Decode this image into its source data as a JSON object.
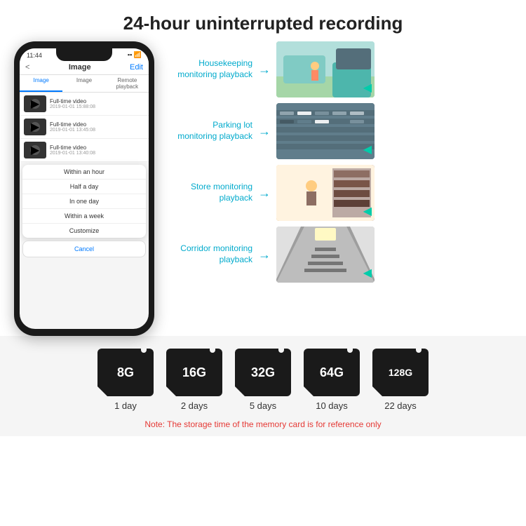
{
  "title": "24-hour uninterrupted recording",
  "phone": {
    "time": "11:44",
    "header_title": "Image",
    "header_left": "<",
    "header_right": "Edit",
    "tabs": [
      "Image",
      "Image",
      "Remote playback"
    ],
    "list_items": [
      {
        "title": "Full-time video",
        "sub": "2019-01-01 15:88:08"
      },
      {
        "title": "Full-time video",
        "sub": "2019-01-01 13:45:08"
      },
      {
        "title": "Full-time video",
        "sub": "2019-01-01 13:40:08"
      }
    ],
    "dropdown": [
      "Within an hour",
      "Half a day",
      "In one day",
      "Within a week",
      "Customize"
    ],
    "cancel": "Cancel"
  },
  "monitoring": [
    {
      "label": "Housekeeping\nmonitoring playback",
      "img_class": "img-housekeeping"
    },
    {
      "label": "Parking lot\nmonitoring playback",
      "img_class": "img-parking"
    },
    {
      "label": "Store monitoring\nplayback",
      "img_class": "img-store"
    },
    {
      "label": "Corridor monitoring\nplayback",
      "img_class": "img-corridor"
    }
  ],
  "storage_cards": [
    {
      "size": "8G",
      "days": "1 day"
    },
    {
      "size": "16G",
      "days": "2 days"
    },
    {
      "size": "32G",
      "days": "5 days"
    },
    {
      "size": "64G",
      "days": "10 days"
    },
    {
      "size": "128G",
      "days": "22 days"
    }
  ],
  "note": "Note: The storage time of the memory card is for reference only"
}
